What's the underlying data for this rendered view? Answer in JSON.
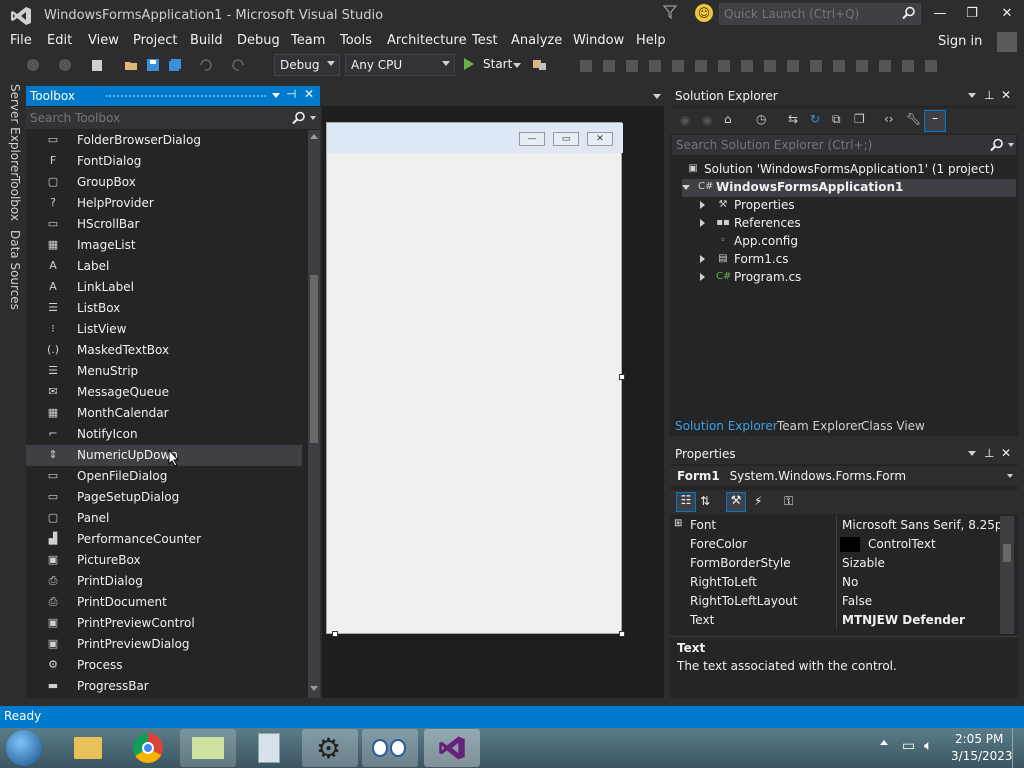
{
  "window": {
    "title": "WindowsFormsApplication1 - Microsoft Visual Studio",
    "quick_launch_placeholder": "Quick Launch (Ctrl+Q)"
  },
  "menu": [
    "File",
    "Edit",
    "View",
    "Project",
    "Build",
    "Debug",
    "Team",
    "Tools",
    "Architecture",
    "Test",
    "Analyze",
    "Window",
    "Help"
  ],
  "account": {
    "signin": "Sign in"
  },
  "toolbar": {
    "config": "Debug",
    "platform": "Any CPU",
    "start": "Start"
  },
  "side_tabs": [
    "Server Explorer",
    "Toolbox",
    "Data Sources"
  ],
  "toolbox": {
    "title": "Toolbox",
    "search_placeholder": "Search Toolbox",
    "items": [
      {
        "label": "FolderBrowserDialog",
        "icon": "folder-dialog-icon",
        "glyph": "▭"
      },
      {
        "label": "FontDialog",
        "icon": "font-dialog-icon",
        "glyph": "F"
      },
      {
        "label": "GroupBox",
        "icon": "groupbox-icon",
        "glyph": "▢"
      },
      {
        "label": "HelpProvider",
        "icon": "help-icon",
        "glyph": "?"
      },
      {
        "label": "HScrollBar",
        "icon": "hscrollbar-icon",
        "glyph": "▭"
      },
      {
        "label": "ImageList",
        "icon": "imagelist-icon",
        "glyph": "▦"
      },
      {
        "label": "Label",
        "icon": "label-icon",
        "glyph": "A"
      },
      {
        "label": "LinkLabel",
        "icon": "linklabel-icon",
        "glyph": "A"
      },
      {
        "label": "ListBox",
        "icon": "listbox-icon",
        "glyph": "☰"
      },
      {
        "label": "ListView",
        "icon": "listview-icon",
        "glyph": "⁝"
      },
      {
        "label": "MaskedTextBox",
        "icon": "maskedtextbox-icon",
        "glyph": "(.)"
      },
      {
        "label": "MenuStrip",
        "icon": "menustrip-icon",
        "glyph": "☰"
      },
      {
        "label": "MessageQueue",
        "icon": "messagequeue-icon",
        "glyph": "✉"
      },
      {
        "label": "MonthCalendar",
        "icon": "calendar-icon",
        "glyph": "▦"
      },
      {
        "label": "NotifyIcon",
        "icon": "notifyicon-icon",
        "glyph": "⌐"
      },
      {
        "label": "NumericUpDown",
        "icon": "numericupdown-icon",
        "glyph": "⇕"
      },
      {
        "label": "OpenFileDialog",
        "icon": "openfile-icon",
        "glyph": "▭"
      },
      {
        "label": "PageSetupDialog",
        "icon": "pagesetup-icon",
        "glyph": "▭"
      },
      {
        "label": "Panel",
        "icon": "panel-icon",
        "glyph": "▢"
      },
      {
        "label": "PerformanceCounter",
        "icon": "perfcounter-icon",
        "glyph": "▟"
      },
      {
        "label": "PictureBox",
        "icon": "picturebox-icon",
        "glyph": "▣"
      },
      {
        "label": "PrintDialog",
        "icon": "printdialog-icon",
        "glyph": "⎙"
      },
      {
        "label": "PrintDocument",
        "icon": "printdocument-icon",
        "glyph": "⎙"
      },
      {
        "label": "PrintPreviewControl",
        "icon": "printpreviewcontrol-icon",
        "glyph": "▣"
      },
      {
        "label": "PrintPreviewDialog",
        "icon": "printpreviewdialog-icon",
        "glyph": "▣"
      },
      {
        "label": "Process",
        "icon": "process-icon",
        "glyph": "⚙"
      },
      {
        "label": "ProgressBar",
        "icon": "progressbar-icon",
        "glyph": "▬"
      }
    ],
    "selected_index": 15
  },
  "solution_explorer": {
    "title": "Solution Explorer",
    "search_placeholder": "Search Solution Explorer (Ctrl+;)",
    "solution": "Solution 'WindowsFormsApplication1' (1 project)",
    "project": "WindowsFormsApplication1",
    "nodes": [
      "Properties",
      "References",
      "App.config",
      "Form1.cs",
      "Program.cs"
    ],
    "tabs": [
      "Solution Explorer",
      "Team Explorer",
      "Class View"
    ]
  },
  "properties": {
    "title": "Properties",
    "object_name": "Form1",
    "object_type": "System.Windows.Forms.Form",
    "rows": [
      {
        "name": "Font",
        "value": "Microsoft Sans Serif, 8.25pt"
      },
      {
        "name": "ForeColor",
        "value": "ControlText"
      },
      {
        "name": "FormBorderStyle",
        "value": "Sizable"
      },
      {
        "name": "RightToLeft",
        "value": "No"
      },
      {
        "name": "RightToLeftLayout",
        "value": "False"
      },
      {
        "name": "Text",
        "value": "MTNJEW Defender"
      }
    ],
    "desc_title": "Text",
    "desc_text": "The text associated with the control."
  },
  "status": {
    "text": "Ready"
  },
  "taskbar": {
    "time": "2:05 PM",
    "date": "3/15/2023"
  },
  "colors": {
    "accent": "#007acc",
    "bg": "#2d2d30",
    "panel": "#252526",
    "vs_purple": "#68217a"
  }
}
